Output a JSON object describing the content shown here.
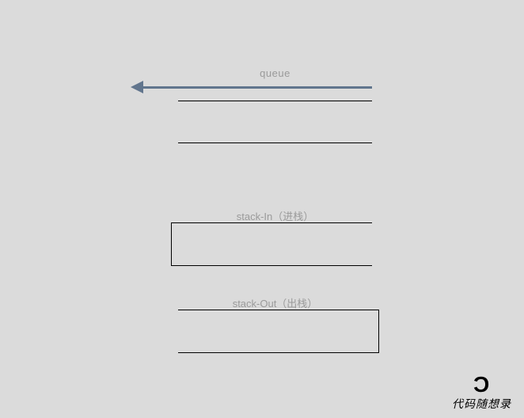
{
  "queue": {
    "label": "queue"
  },
  "stack_in": {
    "label": "stack-In（进栈）"
  },
  "stack_out": {
    "label": "stack-Out（出栈）"
  },
  "watermark": {
    "text": "代码随想录"
  }
}
